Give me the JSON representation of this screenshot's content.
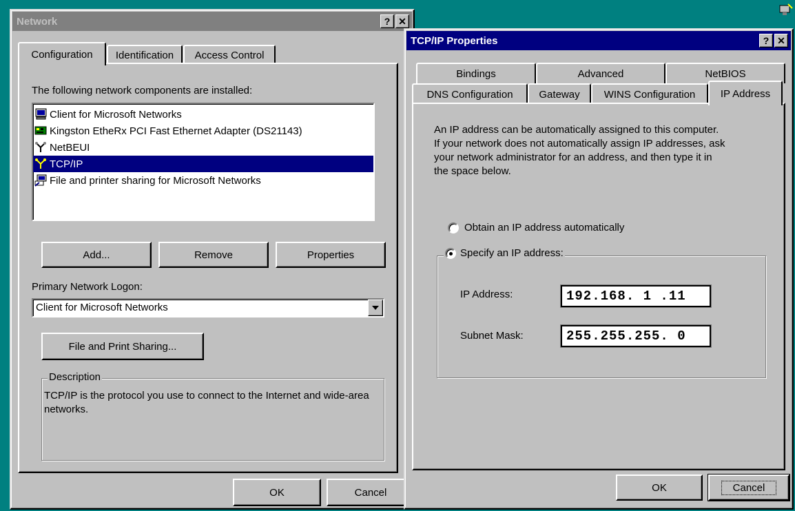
{
  "network_dialog": {
    "title": "Network",
    "tabs": [
      {
        "label": "Configuration"
      },
      {
        "label": "Identification"
      },
      {
        "label": "Access Control"
      }
    ],
    "components_label": "The following network components are installed:",
    "components": [
      {
        "label": "Client for Microsoft Networks",
        "icon": "client-computer-icon"
      },
      {
        "label": "Kingston EtheRx PCI Fast Ethernet Adapter (DS21143)",
        "icon": "network-card-icon"
      },
      {
        "label": "NetBEUI",
        "icon": "protocol-icon"
      },
      {
        "label": "TCP/IP",
        "icon": "protocol-icon",
        "selected": true
      },
      {
        "label": "File and printer sharing for Microsoft Networks",
        "icon": "file-printer-sharing-icon"
      }
    ],
    "add_label": "Add...",
    "remove_label": "Remove",
    "properties_label": "Properties",
    "logon_label": "Primary Network Logon:",
    "logon_value": "Client for Microsoft Networks",
    "file_print_sharing_label": "File and Print Sharing...",
    "description_label": "Description",
    "description_text": "TCP/IP is the protocol you use to connect to the Internet and wide-area networks.",
    "ok_label": "OK",
    "cancel_label": "Cancel"
  },
  "tcpip_dialog": {
    "title": "TCP/IP Properties",
    "tabs_back": [
      {
        "label": "Bindings"
      },
      {
        "label": "Advanced"
      },
      {
        "label": "NetBIOS"
      }
    ],
    "tabs_front": [
      {
        "label": "DNS Configuration"
      },
      {
        "label": "Gateway"
      },
      {
        "label": "WINS Configuration"
      },
      {
        "label": "IP Address",
        "selected": true
      }
    ],
    "intro_lines": [
      "An IP address can be automatically assigned to this computer.",
      "If your network does not automatically assign IP addresses, ask",
      "your network administrator for an address, and then type it in",
      "the space below."
    ],
    "obtain_label": "Obtain an IP address automatically",
    "specify_label": "Specify an IP address:",
    "ip_label": "IP Address:",
    "ip_value": "192.168. 1 .11",
    "mask_label": "Subnet Mask:",
    "mask_value": "255.255.255. 0",
    "ok_label": "OK",
    "cancel_label": "Cancel"
  },
  "colors": {
    "desktop": "#008080",
    "dialog": "#c0c0c0",
    "active_title": "#000080",
    "inactive_title": "#808080",
    "selection": "#000080"
  }
}
